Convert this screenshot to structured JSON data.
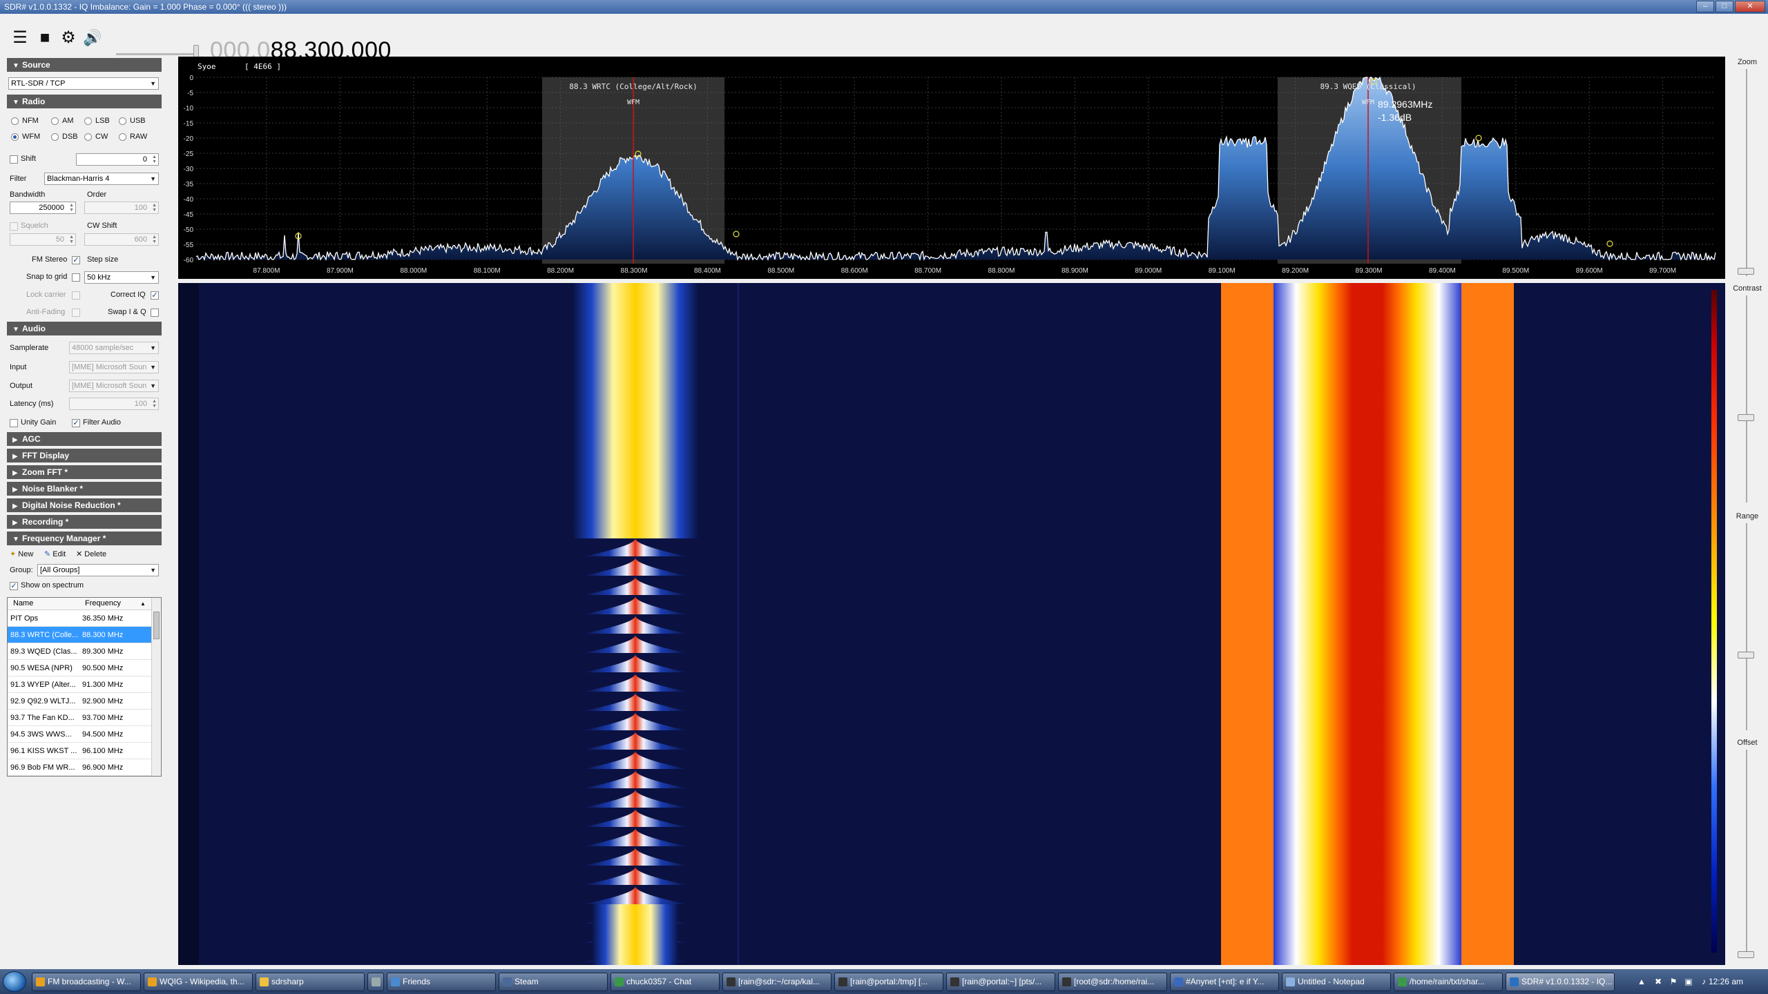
{
  "window": {
    "title": "SDR# v1.0.0.1332 - IQ Imbalance: Gain = 1.000 Phase = 0.000° ((( stereo )))"
  },
  "toolbar": {
    "freq_dim": "000.0",
    "freq_bright": "88.300.000"
  },
  "source": {
    "header": "Source",
    "device": "RTL-SDR / TCP"
  },
  "radio": {
    "header": "Radio",
    "modes_row1": [
      "NFM",
      "AM",
      "LSB",
      "USB"
    ],
    "modes_row2": [
      "WFM",
      "DSB",
      "CW",
      "RAW"
    ],
    "selected_mode": "WFM",
    "shift_label": "Shift",
    "shift_value": "0",
    "filter_label": "Filter",
    "filter_value": "Blackman-Harris 4",
    "bandwidth_label": "Bandwidth",
    "bandwidth_value": "250000",
    "order_label": "Order",
    "order_value": "100",
    "squelch_label": "Squelch",
    "squelch_value": "50",
    "cwshift_label": "CW Shift",
    "cwshift_value": "600",
    "fmstereo_label": "FM Stereo",
    "stepsize_label": "Step size",
    "snap_label": "Snap to grid",
    "step_value": "50 kHz",
    "lockcarrier_label": "Lock carrier",
    "correctiq_label": "Correct IQ",
    "antifading_label": "Anti-Fading",
    "swapiq_label": "Swap I & Q"
  },
  "audio": {
    "header": "Audio",
    "samplerate_label": "Samplerate",
    "samplerate_value": "48000 sample/sec",
    "input_label": "Input",
    "input_value": "[MME] Microsoft Soun",
    "output_label": "Output",
    "output_value": "[MME] Microsoft Soun",
    "latency_label": "Latency (ms)",
    "latency_value": "100",
    "unitygain_label": "Unity Gain",
    "filteraudio_label": "Filter Audio"
  },
  "collapsed_sections": [
    "AGC",
    "FFT Display",
    "Zoom FFT *",
    "Noise Blanker *",
    "Digital Noise Reduction *",
    "Recording *"
  ],
  "freq_manager": {
    "header": "Frequency Manager *",
    "new_label": "New",
    "edit_label": "Edit",
    "delete_label": "Delete",
    "group_label": "Group:",
    "group_value": "[All Groups]",
    "show_label": "Show on spectrum",
    "col_name": "Name",
    "col_freq": "Frequency",
    "rows": [
      {
        "name": "PIT Ops",
        "freq": "36.350 MHz"
      },
      {
        "name": "88.3 WRTC (Colle...",
        "freq": "88.300 MHz"
      },
      {
        "name": "89.3 WQED (Clas...",
        "freq": "89.300 MHz"
      },
      {
        "name": "90.5 WESA (NPR)",
        "freq": "90.500 MHz"
      },
      {
        "name": "91.3 WYEP (Alter...",
        "freq": "91.300 MHz"
      },
      {
        "name": "92.9 Q92.9 WLTJ...",
        "freq": "92.900 MHz"
      },
      {
        "name": "93.7 The Fan KD...",
        "freq": "93.700 MHz"
      },
      {
        "name": "94.5 3WS WWS...",
        "freq": "94.500 MHz"
      },
      {
        "name": "96.1 KISS WKST ...",
        "freq": "96.100 MHz"
      },
      {
        "name": "96.9 Bob FM WR...",
        "freq": "96.900 MHz"
      }
    ],
    "selected_row": 1
  },
  "spectrum": {
    "header_left": "Syoe",
    "header_box": "[ 4E66 ]",
    "x_ticks": [
      "87.800M",
      "87.900M",
      "88.000M",
      "88.100M",
      "88.200M",
      "88.300M",
      "88.400M",
      "88.500M",
      "88.600M",
      "88.700M",
      "88.800M",
      "88.900M",
      "89.000M",
      "89.100M",
      "89.200M",
      "89.300M",
      "89.400M",
      "89.500M",
      "89.600M",
      "89.700M"
    ],
    "y_ticks": [
      "0",
      "-5",
      "-10",
      "-15",
      "-20",
      "-25",
      "-30",
      "-35",
      "-40",
      "-45",
      "-50",
      "-55",
      "-60"
    ],
    "station1_label": "88.3 WRTC (College/Alt/Rock)",
    "station1_mode": "WFM",
    "station2_label": "89.3 WQED (Classical)",
    "station2_mode": "WFM",
    "cursor_freq": "89.2963MHz",
    "cursor_db": "-1.36dB"
  },
  "right_panel": {
    "zoom_label": "Zoom",
    "contrast_label": "Contrast",
    "range_label": "Range",
    "offset_label": "Offset"
  },
  "taskbar": {
    "buttons": [
      "FM broadcasting - W...",
      "WQIG - Wikipedia, th...",
      "sdrsharp",
      "",
      "Friends",
      "Steam",
      "chuck0357 - Chat",
      "[rain@sdr:~/crap/kal...",
      "[rain@portal:/tmp] [...",
      "[rain@portal:~] [pts/...",
      "[root@sdr:/home/rai...",
      "#Anynet [+nt]: e if Y...",
      "Untitled - Notepad",
      "/home/rain/txt/shar...",
      "SDR# v1.0.0.1332 - IQ..."
    ],
    "clock": "12:26 am"
  }
}
